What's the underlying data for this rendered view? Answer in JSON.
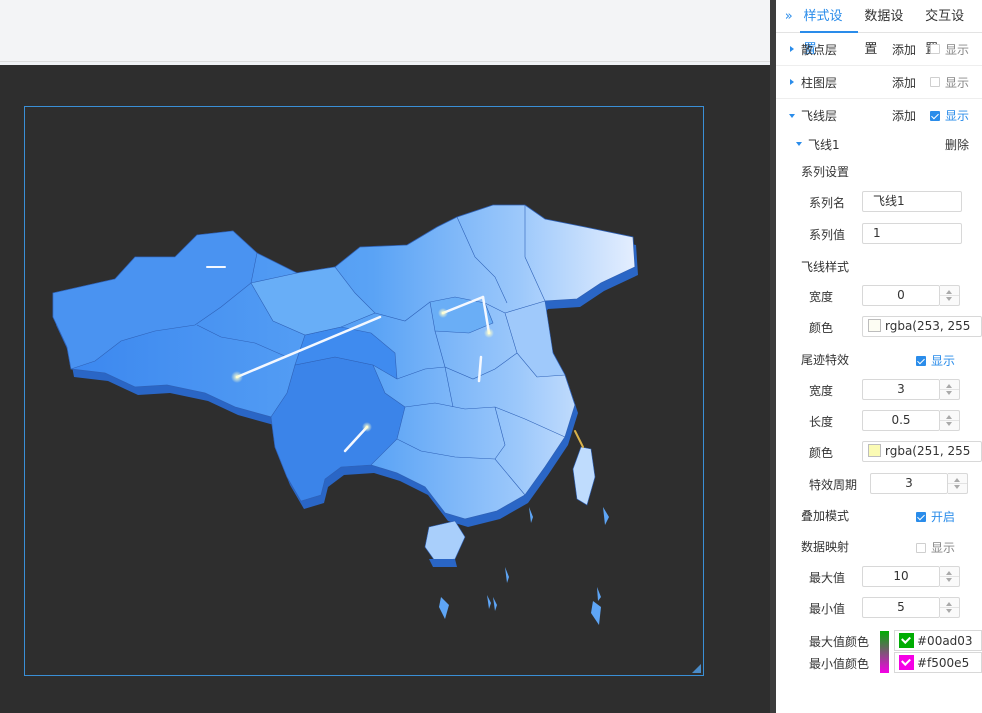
{
  "tabs": [
    "样式设置",
    "数据设置",
    "交互设置"
  ],
  "active_tab": 0,
  "collapse_glyph": "»",
  "layers": [
    {
      "name": "散点层",
      "add": "添加",
      "show": "显示",
      "checked": false,
      "expanded": false
    },
    {
      "name": "柱图层",
      "add": "添加",
      "show": "显示",
      "checked": false,
      "expanded": false
    },
    {
      "name": "飞线层",
      "add": "添加",
      "show": "显示",
      "checked": true,
      "expanded": true
    }
  ],
  "flyline": {
    "item_name": "飞线1",
    "delete": "删除",
    "series_section": "系列设置",
    "series_name_label": "系列名",
    "series_name_value": "飞线1",
    "series_value_label": "系列值",
    "series_value_value": "1",
    "style_section": "飞线样式",
    "width_label": "宽度",
    "width_value": "0",
    "color_label": "颜色",
    "color_value": "rgba(253, 255",
    "color_swatch": "#fdfdf3",
    "trail_section": "尾迹特效",
    "trail_show": "显示",
    "trail_width_label": "宽度",
    "trail_width_value": "3",
    "trail_length_label": "长度",
    "trail_length_value": "0.5",
    "trail_color_label": "颜色",
    "trail_color_value": "rgba(251, 255",
    "trail_color_swatch": "#fbfbb4",
    "period_label": "特效周期",
    "period_value": "3",
    "blend_label": "叠加模式",
    "blend_toggle": "开启",
    "mapping_label": "数据映射",
    "mapping_show": "显示",
    "max_label": "最大值",
    "max_value": "10",
    "min_label": "最小值",
    "min_value": "5",
    "max_color_label": "最大值颜色",
    "max_color_value": "#00ad03",
    "min_color_label": "最小值颜色",
    "min_color_value": "#f500e5"
  },
  "colors": {
    "accent": "#2a8cea",
    "stage_bg": "#2e2e2e",
    "frame_border": "#3a8fd6",
    "max_color": "#00ad03",
    "min_color": "#f500e5"
  }
}
